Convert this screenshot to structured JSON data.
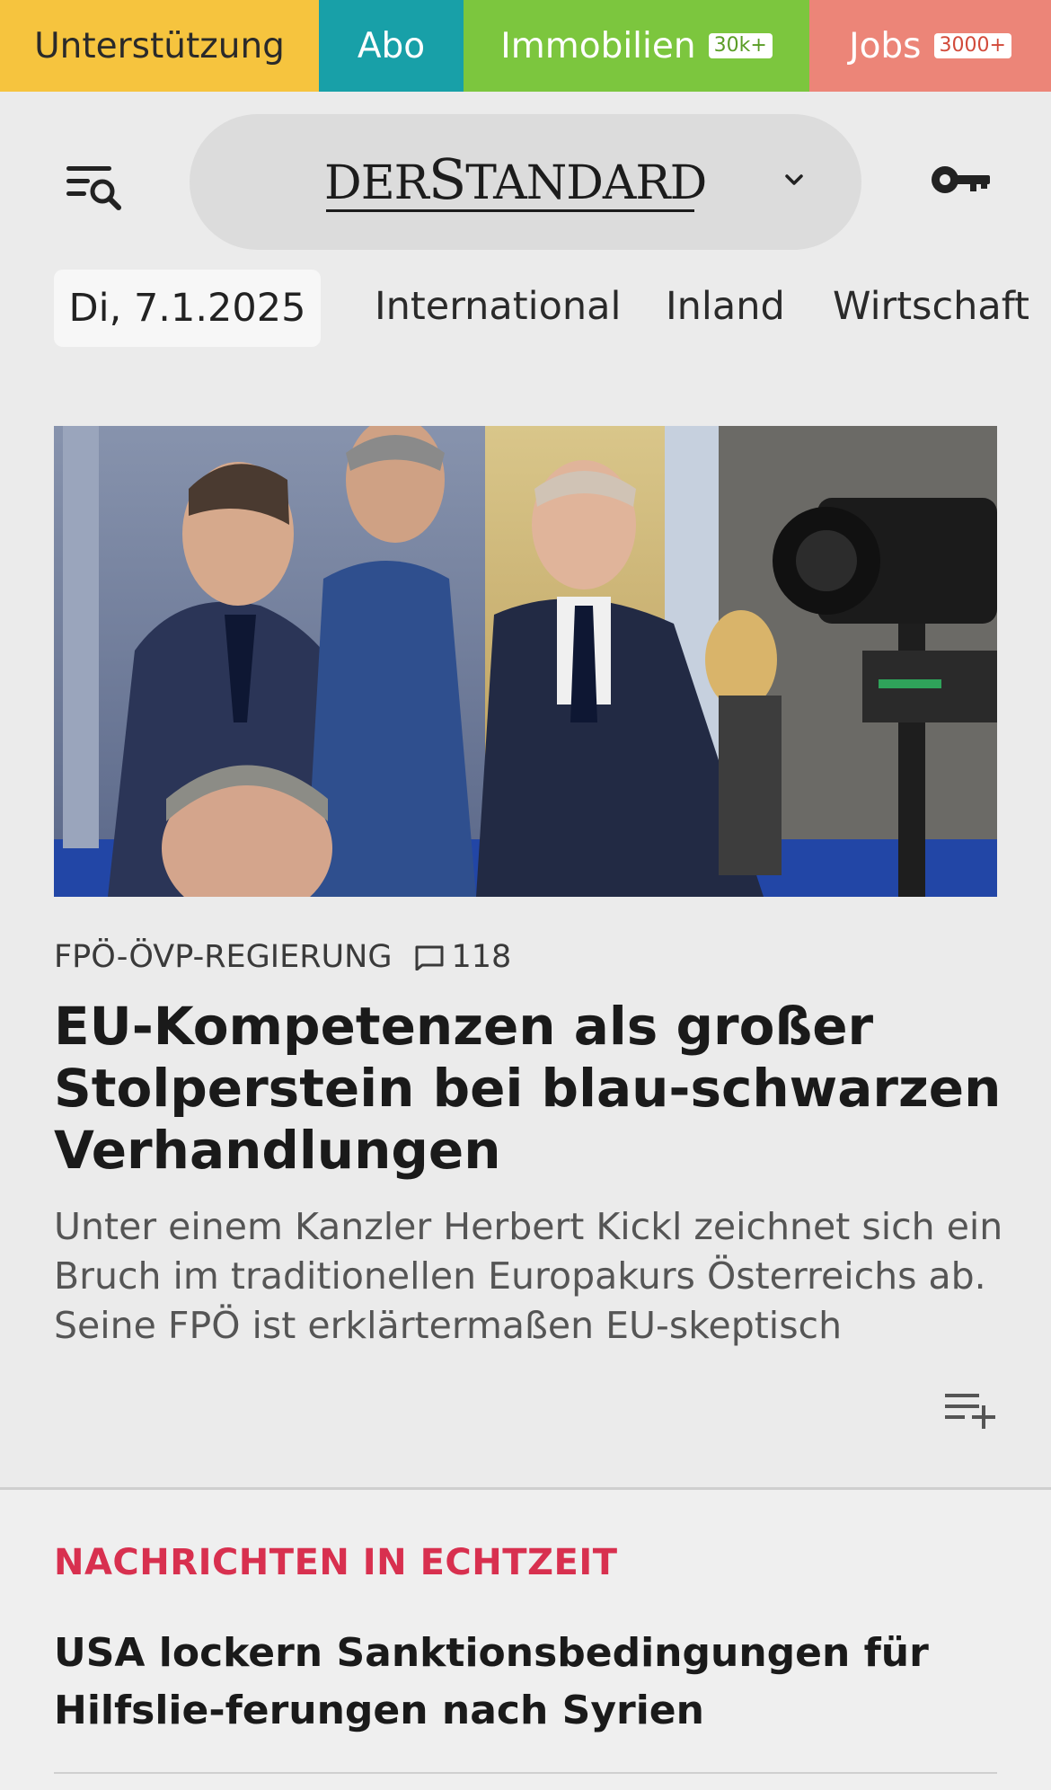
{
  "topnav": {
    "support": "Unterstützung",
    "abo": "Abo",
    "immobilien": "Immobilien",
    "immobilien_badge": "30k+",
    "jobs": "Jobs",
    "jobs_badge": "3000+",
    "colors": {
      "support": "#f6c43e",
      "abo": "#18a0a8",
      "immobilien": "#7cc63e",
      "jobs": "#ec8578"
    }
  },
  "header": {
    "logo_der": "DER",
    "logo_s": "S",
    "logo_tandard": "TANDARD",
    "menu_icon": "menu-search-icon",
    "edition_icon": "chevron-down-icon",
    "login_icon": "key-icon"
  },
  "catbar": {
    "date": "Di, 7.1.2025",
    "categories": [
      "International",
      "Inland",
      "Wirtschaft"
    ]
  },
  "article": {
    "image_icon": "hero-photo",
    "kicker": "FPÖ-ÖVP-REGIERUNG",
    "comment_icon": "comment-icon",
    "comment_count": "118",
    "headline": "EU-Kompetenzen als großer Stolperstein bei blau-schwarzen Verhandlungen",
    "teaser": "Unter einem Kanzler Herbert Kickl zeichnet sich ein Bruch im traditionellen Europakurs Österreichs ab. Seine FPÖ ist erklärtermaßen EU-skeptisch",
    "watchlist_icon": "add-to-list-icon"
  },
  "live": {
    "title": "NACHRICHTEN IN ECHTZEIT",
    "title_color": "#d8304f",
    "headline": "USA lockern Sanktionsbedingungen für Hilfslie-ferungen nach Syrien"
  }
}
